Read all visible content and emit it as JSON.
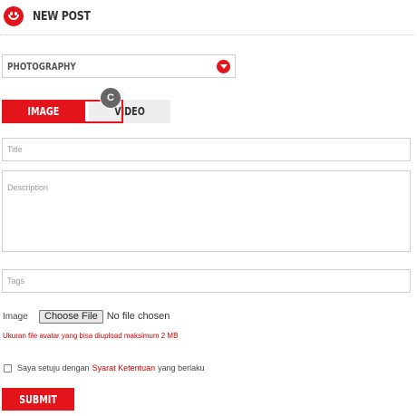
{
  "header": {
    "title": "NEW POST",
    "logo_icon": "smiley-icon",
    "accent": "#e4141b"
  },
  "category": {
    "selected": "PHOTOGRAPHY",
    "arrow_icon": "chevron-down-icon"
  },
  "tabs": [
    {
      "label": "IMAGE",
      "active": true
    },
    {
      "label": "VIDEO",
      "active": false
    }
  ],
  "tab_marker": "C",
  "form": {
    "title_placeholder": "Title",
    "description_placeholder": "Description",
    "tags_placeholder": "Tags",
    "image_label": "Image",
    "choose_file_label": "Choose File",
    "file_status": "No file chosen",
    "hint": "Ukuran file avatar yang bisa diupload maksimum 2 MB",
    "agree_prefix": "Saya setuju dengan",
    "agree_link": "Syarat Ketentuan",
    "agree_suffix": "yang berlaku",
    "submit_label": "SUBMIT"
  }
}
